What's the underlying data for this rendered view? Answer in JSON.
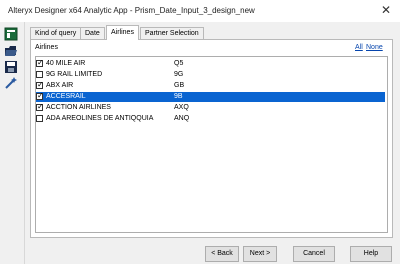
{
  "window": {
    "title": "Alteryx Designer x64  Analytic App  -  Prism_Date_Input_3_design_new",
    "close_glyph": "✕"
  },
  "toolbar": {
    "icons": [
      "app-tool-icon",
      "open-folder-icon",
      "save-icon",
      "magic-wand-icon"
    ]
  },
  "tabs": [
    {
      "label": "Kind of query",
      "active": false
    },
    {
      "label": "Date",
      "active": false
    },
    {
      "label": "Airlines",
      "active": true
    },
    {
      "label": "Partner Selection",
      "active": false
    }
  ],
  "airlines_panel": {
    "label": "Airlines",
    "all_link": "All",
    "none_link": "None",
    "items": [
      {
        "name": "40 MILE AIR",
        "code": "Q5",
        "checked": true,
        "selected": false
      },
      {
        "name": "9G RAIL LIMITED",
        "code": "9G",
        "checked": false,
        "selected": false
      },
      {
        "name": "ABX AIR",
        "code": "GB",
        "checked": true,
        "selected": false
      },
      {
        "name": "ACCESRAIL",
        "code": "9B",
        "checked": true,
        "selected": true
      },
      {
        "name": "ACCTION AIRLINES",
        "code": "AXQ",
        "checked": true,
        "selected": false
      },
      {
        "name": "ADA AREOLINES DE ANTIQQUIA",
        "code": "ANQ",
        "checked": false,
        "selected": false
      }
    ]
  },
  "buttons": {
    "back": "< Back",
    "next": "Next >",
    "cancel": "Cancel",
    "help": "Help"
  },
  "colors": {
    "selection": "#0a64d1",
    "link": "#0645ad"
  }
}
